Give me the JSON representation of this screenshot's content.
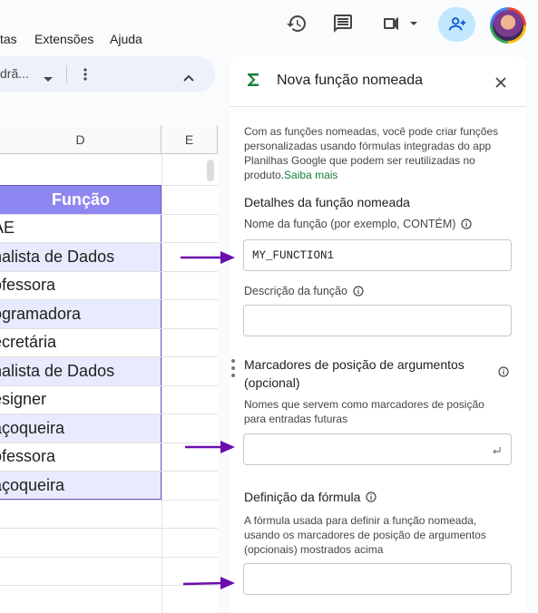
{
  "menu": {
    "items": [
      "tas",
      "Extensões",
      "Ajuda"
    ]
  },
  "toolbar": {
    "style_value": "drã..."
  },
  "sheet": {
    "columns": [
      "D",
      "E"
    ],
    "header": "Função",
    "rows": [
      "AE",
      "nalista de Dados",
      "ofessora",
      "ogramadora",
      "ecretária",
      "nalista de Dados",
      "esigner",
      "açoqueira",
      "ofessora",
      "açoqueira"
    ]
  },
  "panel": {
    "title": "Nova função nomeada",
    "intro": "Com as funções nomeadas, você pode criar funções personalizadas usando fórmulas integradas do app Planilhas Google que podem ser reutilizadas no produto.",
    "learn_more": "Saiba mais",
    "details_heading": "Detalhes da função nomeada",
    "name_label": "Nome da função (por exemplo, CONTÉM)",
    "name_value": "MY_FUNCTION1",
    "description_label": "Descrição da função",
    "description_value": "",
    "args_heading": "Marcadores de posição de argumentos (opcional)",
    "args_help": "Nomes que servem como marcadores de posição para entradas futuras",
    "args_value": "",
    "formula_heading": "Definição da fórmula",
    "formula_help": "A fórmula usada para definir a função nomeada, usando os marcadores de posição de argumentos (opcionais) mostrados acima",
    "formula_value": ""
  },
  "colors": {
    "accent_green": "#188038",
    "arrow_purple": "#6a0dad",
    "table_header": "#8f87f1",
    "band": "#e8eafd"
  },
  "icons": [
    "history-icon",
    "comment-icon",
    "meet-icon",
    "share-add-person-icon",
    "avatar",
    "sigma-icon",
    "close-icon",
    "info-icon",
    "enter-icon",
    "drag-handle-icon"
  ]
}
